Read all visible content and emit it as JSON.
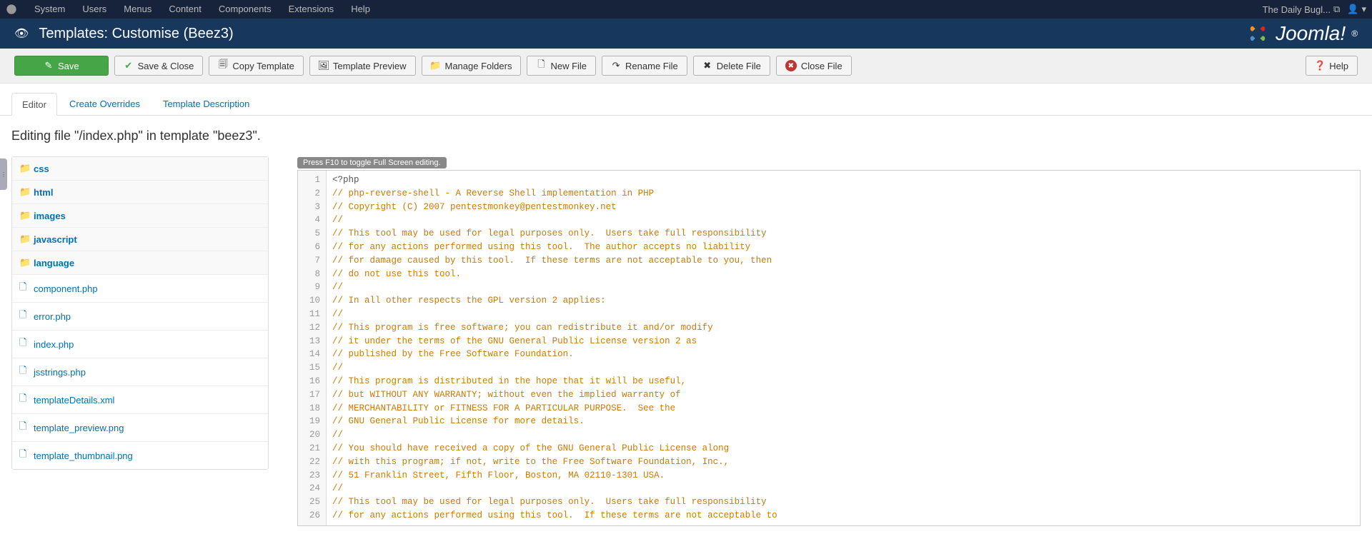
{
  "topmenu": {
    "items": [
      "System",
      "Users",
      "Menus",
      "Content",
      "Components",
      "Extensions",
      "Help"
    ],
    "site_link": "The Daily Bugl...",
    "user_dropdown": "▾"
  },
  "header": {
    "title": "Templates: Customise (Beez3)",
    "brand": "Joomla!"
  },
  "toolbar": {
    "save": "Save",
    "save_close": "Save & Close",
    "copy": "Copy Template",
    "preview": "Template Preview",
    "folders": "Manage Folders",
    "new_file": "New File",
    "rename": "Rename File",
    "delete": "Delete File",
    "close": "Close File",
    "help": "Help"
  },
  "tabs": {
    "editor": "Editor",
    "overrides": "Create Overrides",
    "description": "Template Description"
  },
  "editing_msg": "Editing file \"/index.php\" in template \"beez3\".",
  "f10_tip": "Press F10 to toggle Full Screen editing.",
  "tree": {
    "folders": [
      "css",
      "html",
      "images",
      "javascript",
      "language"
    ],
    "files": [
      "component.php",
      "error.php",
      "index.php",
      "jsstrings.php",
      "templateDetails.xml",
      "template_preview.png",
      "template_thumbnail.png"
    ]
  },
  "code": {
    "lines": [
      {
        "n": 1,
        "t": "meta",
        "c": "<?php"
      },
      {
        "n": 2,
        "t": "comment",
        "c": "// php-reverse-shell - A Reverse Shell implementation in PHP"
      },
      {
        "n": 3,
        "t": "comment",
        "c": "// Copyright (C) 2007 pentestmonkey@pentestmonkey.net"
      },
      {
        "n": 4,
        "t": "comment",
        "c": "//"
      },
      {
        "n": 5,
        "t": "comment",
        "c": "// This tool may be used for legal purposes only.  Users take full responsibility"
      },
      {
        "n": 6,
        "t": "comment",
        "c": "// for any actions performed using this tool.  The author accepts no liability"
      },
      {
        "n": 7,
        "t": "comment",
        "c": "// for damage caused by this tool.  If these terms are not acceptable to you, then"
      },
      {
        "n": 8,
        "t": "comment",
        "c": "// do not use this tool."
      },
      {
        "n": 9,
        "t": "comment",
        "c": "//"
      },
      {
        "n": 10,
        "t": "comment",
        "c": "// In all other respects the GPL version 2 applies:"
      },
      {
        "n": 11,
        "t": "comment",
        "c": "//"
      },
      {
        "n": 12,
        "t": "comment",
        "c": "// This program is free software; you can redistribute it and/or modify"
      },
      {
        "n": 13,
        "t": "comment",
        "c": "// it under the terms of the GNU General Public License version 2 as"
      },
      {
        "n": 14,
        "t": "comment",
        "c": "// published by the Free Software Foundation."
      },
      {
        "n": 15,
        "t": "comment",
        "c": "//"
      },
      {
        "n": 16,
        "t": "comment",
        "c": "// This program is distributed in the hope that it will be useful,"
      },
      {
        "n": 17,
        "t": "comment",
        "c": "// but WITHOUT ANY WARRANTY; without even the implied warranty of"
      },
      {
        "n": 18,
        "t": "comment",
        "c": "// MERCHANTABILITY or FITNESS FOR A PARTICULAR PURPOSE.  See the"
      },
      {
        "n": 19,
        "t": "comment",
        "c": "// GNU General Public License for more details."
      },
      {
        "n": 20,
        "t": "comment",
        "c": "//"
      },
      {
        "n": 21,
        "t": "comment",
        "c": "// You should have received a copy of the GNU General Public License along"
      },
      {
        "n": 22,
        "t": "comment",
        "c": "// with this program; if not, write to the Free Software Foundation, Inc.,"
      },
      {
        "n": 23,
        "t": "comment",
        "c": "// 51 Franklin Street, Fifth Floor, Boston, MA 02110-1301 USA."
      },
      {
        "n": 24,
        "t": "comment",
        "c": "//"
      },
      {
        "n": 25,
        "t": "comment",
        "c": "// This tool may be used for legal purposes only.  Users take full responsibility"
      },
      {
        "n": 26,
        "t": "comment",
        "c": "// for any actions performed using this tool.  If these terms are not acceptable to"
      }
    ]
  }
}
